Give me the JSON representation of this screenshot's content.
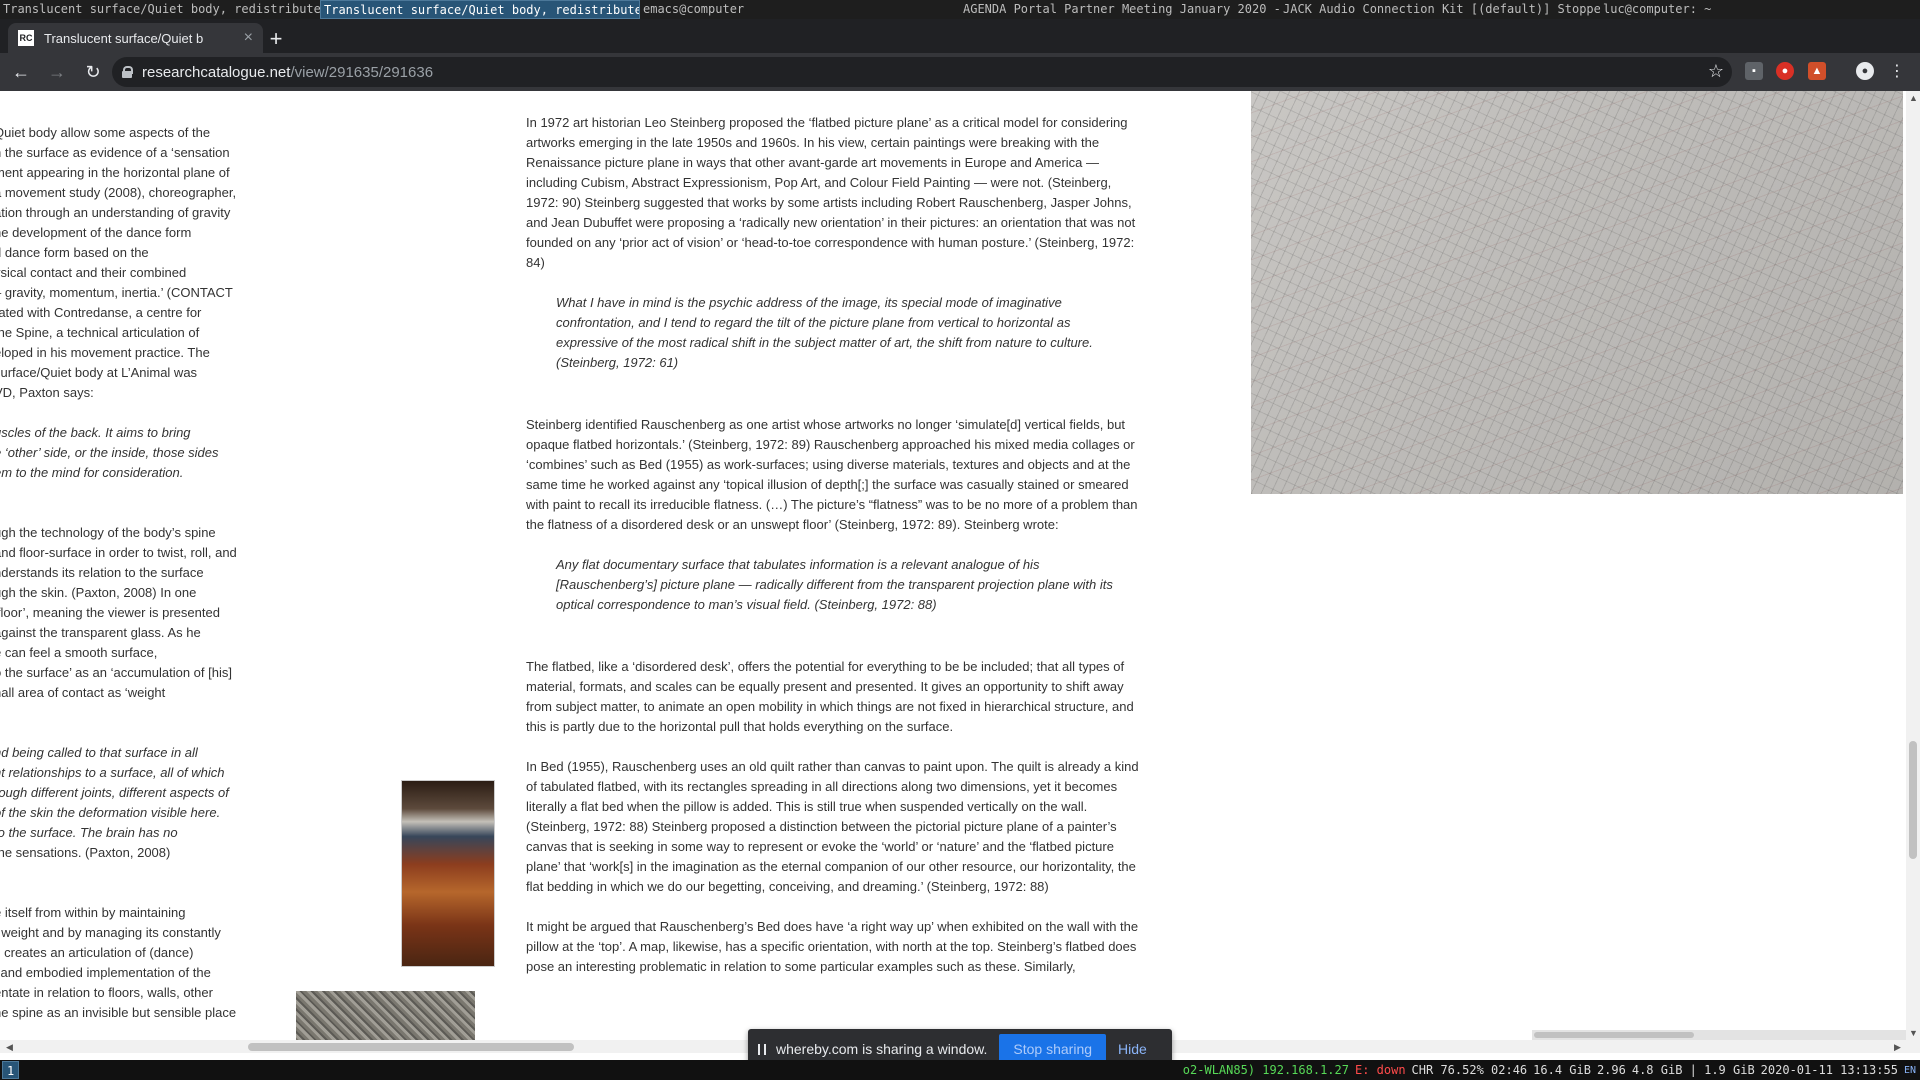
{
  "wm": {
    "windows": [
      "Translucent surface/Quiet body, redistribute…",
      "Translucent surface/Quiet body, redistribute…",
      "emacs@computer",
      "AGENDA Portal Partner Meeting January 2020 -…",
      "JACK Audio Connection Kit [(default)] Stoppe…",
      "luc@computer: ~"
    ]
  },
  "browser": {
    "tab_title": "Translucent surface/Quiet b",
    "favicon_text": "RC",
    "new_tab": "+",
    "url_host": "researchcatalogue.net",
    "url_path": "/view/291635/291636"
  },
  "left_column": {
    "lines": [
      "Quiet body allow some aspects of the",
      "n the surface as evidence of a ‘sensation",
      "ment appearing in the horizontal plane of",
      "a movement study (2008), choreographer,",
      "ation through an understanding of gravity",
      "he development of the dance form",
      "d dance form based on the",
      "ysical contact and their combined",
      "– gravity, momentum, inertia.’ (CONTACT",
      "rated with Contredanse, a centre for",
      "the Spine, a technical articulation of",
      "eloped in his movement practice. The",
      "surface/Quiet body at L’Animal was",
      "VD, Paxton says:",
      "",
      "uscles of the back. It aims to bring",
      "e ‘other’ side, or the inside, those sides",
      "em to the mind for consideration.",
      "",
      "",
      "ugh the technology of the body’s spine",
      "and floor-surface in order to twist, roll, and",
      "nderstands its relation to the surface",
      "ugh the skin. (Paxton, 2008) In one",
      "‘floor’, meaning the viewer is presented",
      "against the transparent glass. As he",
      "e can feel a smooth surface,",
      "o the surface’ as an ‘accumulation of [his]",
      "nall area of contact as ‘weight",
      "",
      "",
      "nd being called to that surface in all",
      "nt relationships to a surface, all of which",
      "rough different joints, different aspects of",
      "of the skin the deformation visible here.",
      "to the surface. The brain has no",
      "the sensations. (Paxton, 2008)",
      "",
      "",
      "e itself from within by maintaining",
      "f weight and by managing its constantly",
      "s creates an articulation of (dance)",
      "l and embodied implementation of the",
      "entate in relation to floors, walls, other",
      "he spine as an invisible but sensible place"
    ]
  },
  "article": {
    "p1": "In 1972 art historian Leo Steinberg proposed the ‘flatbed picture plane’ as a critical model for considering artworks emerging in the late 1950s and 1960s. In his view, certain paintings were breaking with the Renaissance picture plane in ways that other avant-garde art movements in Europe and America — including Cubism, Abstract Expressionism, Pop Art, and Colour Field Painting — were not. (Steinberg, 1972: 90) Steinberg suggested that works by some artists including Robert Rauschenberg, Jasper Johns, and Jean Dubuffet were proposing a ‘radically new orientation’ in their pictures: an orientation that was not founded on any ‘prior act of vision’ or ‘head-to-toe correspondence with human posture.’ (Steinberg, 1972: 84)",
    "quote1": "What I have in mind is the psychic address of the image, its special mode of imaginative confrontation, and I tend to regard the tilt of the picture plane from vertical to horizontal as expressive of the most radical shift in the subject matter of art, the shift from nature to culture. (Steinberg, 1972: 61)",
    "p2": "Steinberg identified Rauschenberg as one artist whose artworks no longer ‘simulate[d] vertical fields, but opaque flatbed horizontals.’ (Steinberg, 1972: 89) Rauschenberg approached his mixed media collages or ‘combines’ such as Bed (1955) as work-surfaces; using diverse materials, textures and objects and at the same time he worked against any ‘topical illusion of depth[;] the surface was casually stained or smeared with paint to recall its irreducible flatness. (…) The picture’s “flatness” was to be no more of a problem than the flatness of a disordered desk or an unswept floor’ (Steinberg, 1972: 89). Steinberg wrote:",
    "quote2": "Any flat documentary surface that tabulates information is a relevant analogue of his [Rauschenberg’s] picture plane — radically different from the transparent projection plane with its optical correspondence to man’s visual field. (Steinberg, 1972: 88)",
    "p3": "The flatbed, like a ‘disordered desk’, offers the potential for everything to be be included; that all types of material, formats, and scales can be equally present and presented. It gives an opportunity to shift away from subject matter, to animate an open mobility in which things are not fixed in hierarchical structure, and this is partly due to the horizontal pull that holds everything on the surface.",
    "p4": "In Bed (1955), Rauschenberg uses an old quilt rather than canvas to paint upon. The quilt is already a kind of tabulated flatbed, with its rectangles spreading in all directions along two dimensions, yet it becomes literally a flat bed when the pillow is added. This is still true when suspended vertically on the wall. (Steinberg, 1972: 88) Steinberg proposed a distinction between the pictorial picture plane of a painter’s canvas that is seeking in some way to represent or evoke the ‘world’ or ‘nature’ and the ‘flatbed picture plane’ that ‘work[s] in the imagination as the eternal companion of our other resource, our horizontality, the flat bedding in which we do our begetting, conceiving, and dreaming.’ (Steinberg, 1972: 88)",
    "p5": "It might be argued that Rauschenberg’s Bed does have ‘a right way up’ when exhibited on the wall with the pillow at the ‘top’. A map, likewise, has a specific orientation, with north at the top. Steinberg’s flatbed does pose an interesting problematic in relation to some particular examples such as these. Similarly,"
  },
  "share": {
    "message": "whereby.com is sharing a window.",
    "stop": "Stop sharing",
    "hide": "Hide"
  },
  "statusbar": {
    "workspace": "1",
    "wifi": "o2-WLAN85) 192.168.1.27",
    "eth": "E: down",
    "battery": "CHR 76.52% 02:46",
    "disk": "16.4 GiB",
    "load": "2.96",
    "mem": "4.8 GiB | 1.9 GiB",
    "datetime": "2020-01-11 13:13:55",
    "lang": "EN"
  },
  "colors": {
    "accent": "#1a73e8",
    "wm_active": "#285577",
    "chrome_dark": "#35363a"
  }
}
